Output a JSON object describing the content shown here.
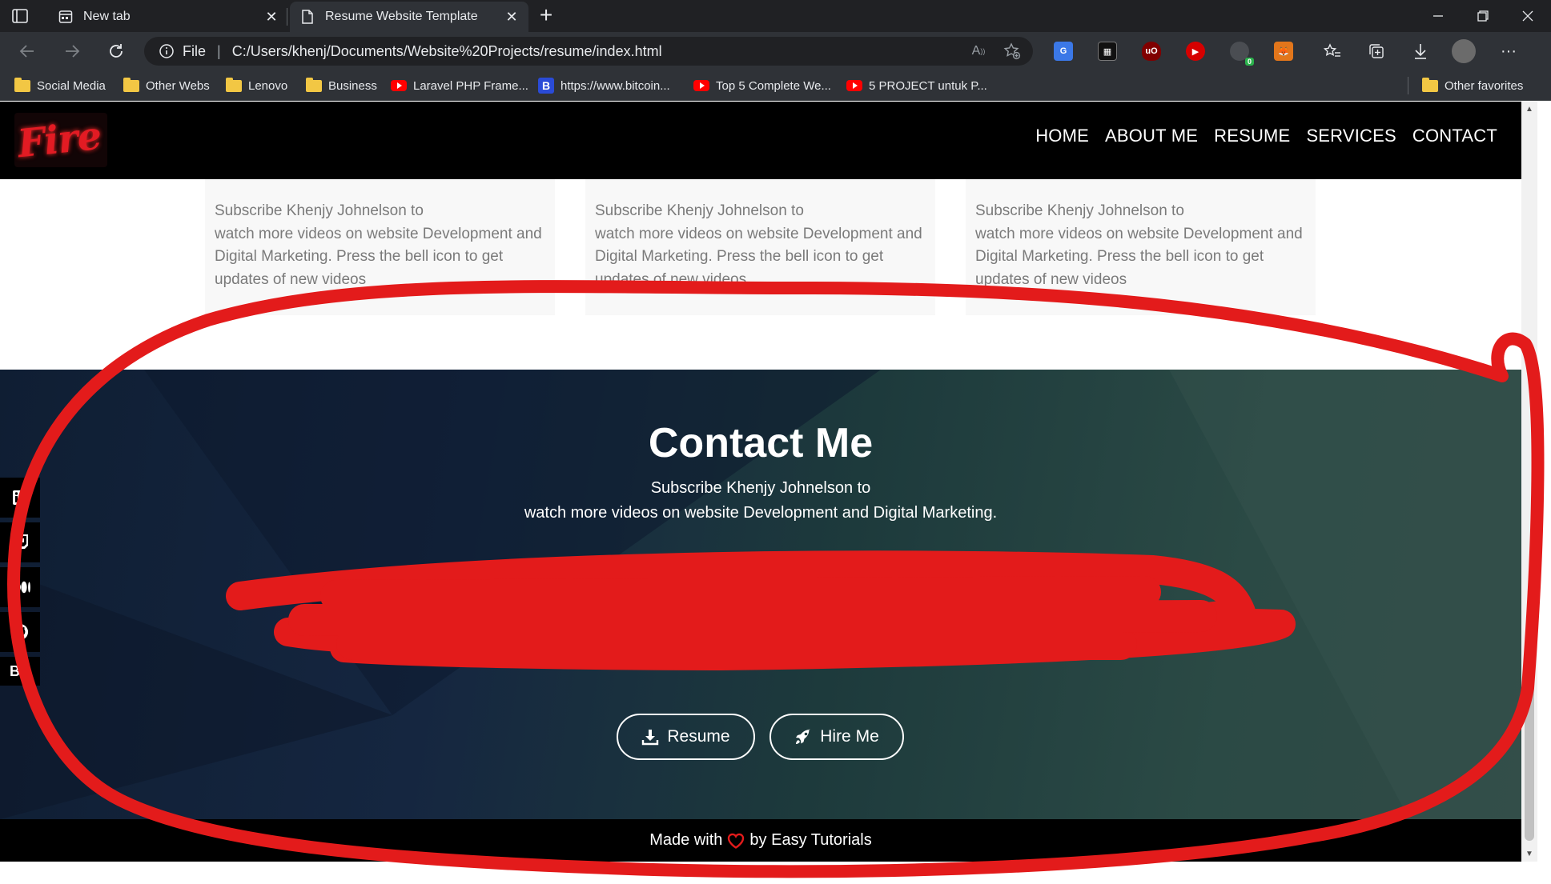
{
  "browser": {
    "tabs": [
      {
        "title": "New tab",
        "active": false
      },
      {
        "title": "Resume Website Template",
        "active": true
      }
    ],
    "address": {
      "scheme": "File",
      "url": "C:/Users/khenj/Documents/Website%20Projects/resume/index.html"
    },
    "bookmarks": [
      {
        "label": "Social Media",
        "icon": "folder-icon"
      },
      {
        "label": "Other Webs",
        "icon": "folder-icon"
      },
      {
        "label": "Lenovo",
        "icon": "folder-icon"
      },
      {
        "label": "Business",
        "icon": "folder-icon"
      },
      {
        "label": "Laravel PHP Frame...",
        "icon": "youtube-icon"
      },
      {
        "label": "https://www.bitcoin...",
        "icon": "b-icon"
      },
      {
        "label": "Top 5 Complete We...",
        "icon": "youtube-icon"
      },
      {
        "label": "5 PROJECT untuk P...",
        "icon": "youtube-icon"
      }
    ],
    "other_favorites": "Other favorites",
    "extension_badge": "0"
  },
  "site": {
    "logo_text": "Fire",
    "nav": [
      "HOME",
      "ABOUT ME",
      "RESUME",
      "SERVICES",
      "CONTACT"
    ],
    "cards": [
      {
        "line1": "Subscribe Khenjy Johnelson to",
        "body": "watch more videos on website Development and Digital Marketing. Press the bell icon to get updates of new videos"
      },
      {
        "line1": "Subscribe Khenjy Johnelson to",
        "body": "watch more videos on website Development and Digital Marketing. Press the bell icon to get updates of new videos"
      },
      {
        "line1": "Subscribe Khenjy Johnelson to",
        "body": "watch more videos on website Development and Digital Marketing. Press the bell icon to get updates of new videos"
      }
    ],
    "contact": {
      "title": "Contact Me",
      "line1": "Subscribe Khenjy Johnelson to",
      "line2": "watch more videos on website Development and Digital Marketing.",
      "buttons": {
        "resume": "Resume",
        "hire": "Hire Me"
      }
    },
    "social": [
      "linkedin-icon",
      "twitch-icon",
      "medium-icon",
      "github-icon",
      "b-icon"
    ],
    "social_partial_letter": "B",
    "footer": {
      "before": "Made with",
      "after": "by Easy Tutorials"
    }
  },
  "colors": {
    "annotation_red": "#e31b1b",
    "heart_red": "#e31b1b",
    "chrome_dark": "#202124",
    "chrome_toolbar": "#2f3237"
  }
}
